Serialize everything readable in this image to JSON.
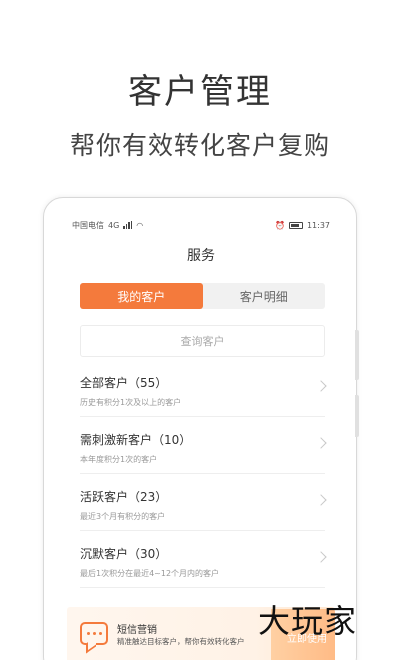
{
  "promo": {
    "title": "客户管理",
    "subtitle": "帮你有效转化客户复购"
  },
  "status_bar": {
    "carrier": "中国电信",
    "network": "4G",
    "time": "11:37"
  },
  "nav": {
    "title": "服务"
  },
  "tabs": [
    {
      "label": "我的客户",
      "active": true
    },
    {
      "label": "客户明细",
      "active": false
    }
  ],
  "search": {
    "placeholder": "查询客户"
  },
  "customers": [
    {
      "title": "全部客户（55）",
      "desc": "历史有积分1次及以上的客户"
    },
    {
      "title": "需刺激新客户（10）",
      "desc": "本年度积分1次的客户"
    },
    {
      "title": "活跃客户（23）",
      "desc": "最近3个月有积分的客户"
    },
    {
      "title": "沉默客户（30）",
      "desc": "最后1次积分在最近4~12个月内的客户"
    }
  ],
  "banner": {
    "title": "短信营销",
    "desc": "精准触达目标客户，帮你有效转化客户",
    "button": "立即使用"
  },
  "watermark": "大玩家",
  "colors": {
    "accent": "#f47a3c"
  }
}
